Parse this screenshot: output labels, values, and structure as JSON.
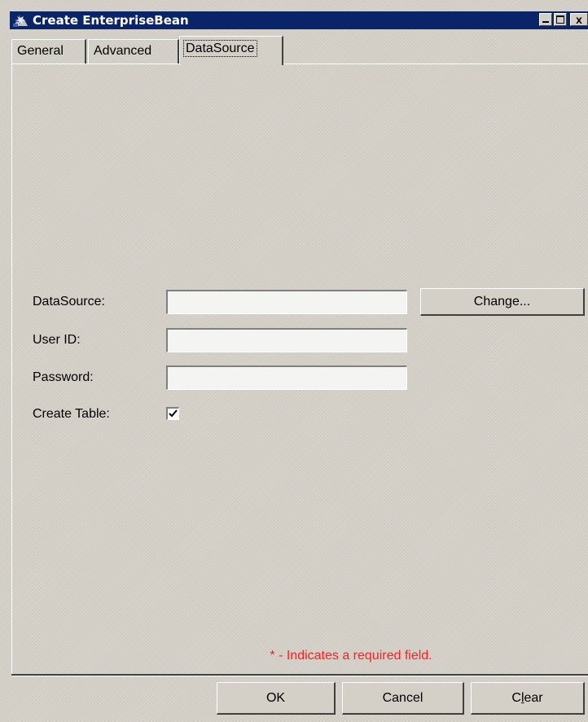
{
  "window": {
    "title": "Create EnterpriseBean",
    "controls": {
      "close_glyph": "x"
    }
  },
  "tabs": [
    {
      "label": "General",
      "active": false
    },
    {
      "label": "Advanced",
      "active": false
    },
    {
      "label": "DataSource",
      "active": true
    }
  ],
  "form": {
    "datasource_label": "DataSource:",
    "datasource_value": "",
    "change_button": "Change...",
    "user_id_label": "User ID:",
    "user_id_value": "",
    "password_label": "Password:",
    "password_value": "",
    "create_table_label": "Create Table:",
    "create_table_checked": true
  },
  "required_note": "* - Indicates a required field.",
  "buttons": {
    "ok": "OK",
    "cancel": "Cancel",
    "clear_prefix": "C",
    "clear_mnemonic": "l",
    "clear_suffix": "ear"
  },
  "colors": {
    "titlebar": "#0a246a",
    "panel": "#d4d0c8",
    "required_text": "#ff2020"
  }
}
